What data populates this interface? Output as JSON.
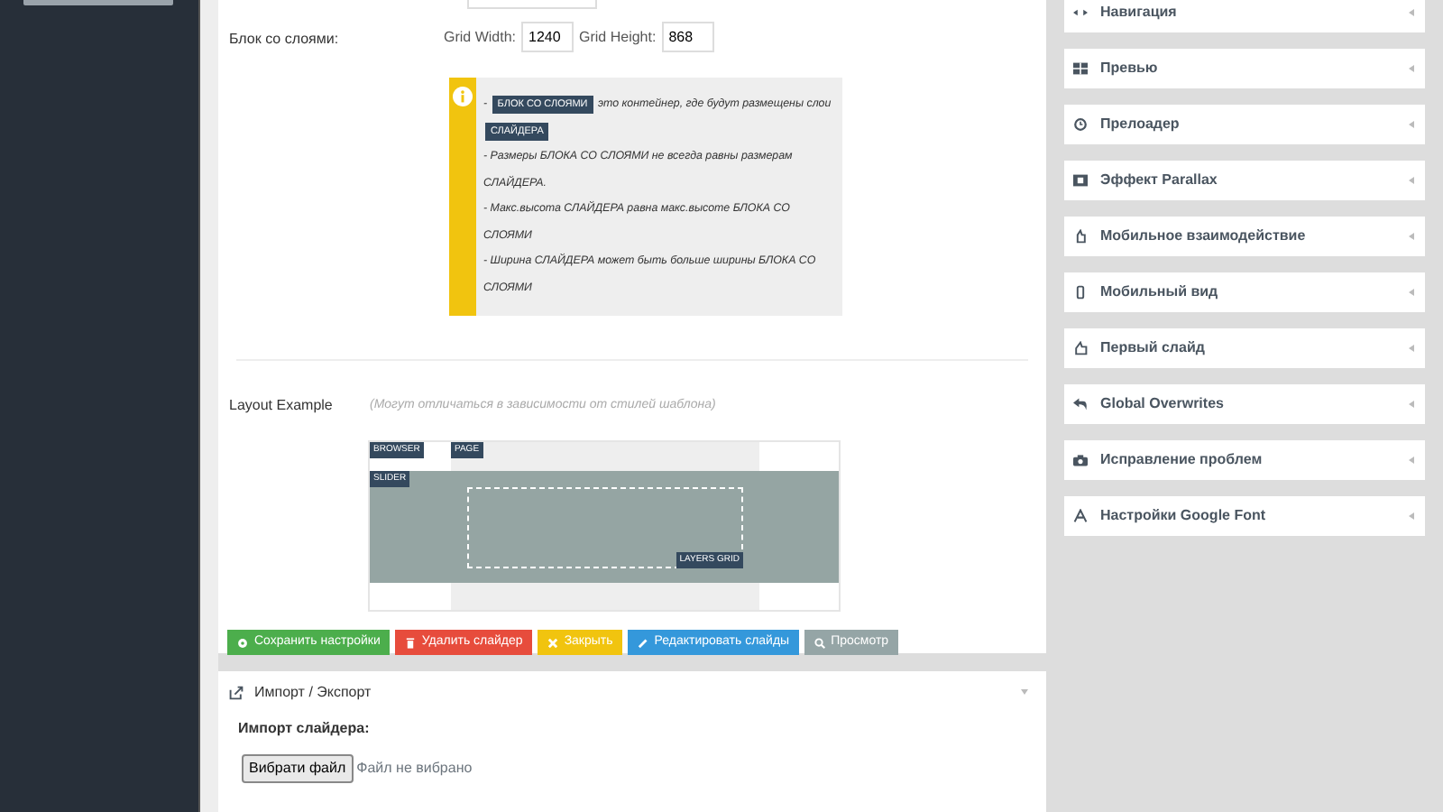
{
  "grid_settings": {
    "label": "Блок со слоями:",
    "fields": [
      {
        "label": "Grid Width:",
        "value": "1240"
      },
      {
        "label": "Grid Height:",
        "value": "868"
      }
    ]
  },
  "info_box": {
    "paragraphs": [
      [
        {
          "kind": "text",
          "text": "-"
        },
        {
          "kind": "tag",
          "text": "БЛОК СО СЛОЯМИ"
        },
        {
          "kind": "text",
          "text": "это контейнер, где будут размещены слои"
        },
        {
          "kind": "tag",
          "text": "СЛАЙДЕРА"
        }
      ],
      [
        {
          "kind": "text",
          "text": "- Размеры БЛОКА СО СЛОЯМИ не всегда равны размерам СЛАЙДЕРА."
        }
      ],
      [
        {
          "kind": "text",
          "text": "- Макс.высота СЛАЙДЕРА равна макс.высоте БЛОКА СО СЛОЯМИ"
        }
      ],
      [
        {
          "kind": "text",
          "text": "- Ширина СЛАЙДЕРА может быть больше ширины БЛОКА СО СЛОЯМИ"
        }
      ]
    ]
  },
  "layout_example": {
    "label": "Layout Example",
    "note": "(Могут отличаться в зависимости от стилей шаблона)",
    "tags": {
      "browser": "BROWSER",
      "page": "PAGE",
      "slider": "SLIDER",
      "grid": "LAYERS GRID"
    }
  },
  "actions": [
    {
      "label": "Сохранить настройки",
      "kind": "save"
    },
    {
      "label": "Удалить слайдер",
      "kind": "delete"
    },
    {
      "label": "Закрыть",
      "kind": "close"
    },
    {
      "label": "Редактировать слайды",
      "kind": "edit"
    },
    {
      "label": "Просмотр",
      "kind": "preview"
    }
  ],
  "import_export": {
    "title": "Импорт / Экспорт",
    "import_label": "Импорт слайдера:",
    "file_button": "Вибрати файл",
    "file_status": "Файл не вибрано"
  },
  "side_panels": [
    {
      "title": "Навигация"
    },
    {
      "title": "Превью"
    },
    {
      "title": "Прелоадер"
    },
    {
      "title": "Эффект Parallax"
    },
    {
      "title": "Мобильное взаимодействие"
    },
    {
      "title": "Мобильный вид"
    },
    {
      "title": "Первый слайд"
    },
    {
      "title": "Global Overwrites"
    },
    {
      "title": "Исправление проблем"
    },
    {
      "title": "Настройки Google Font"
    }
  ]
}
